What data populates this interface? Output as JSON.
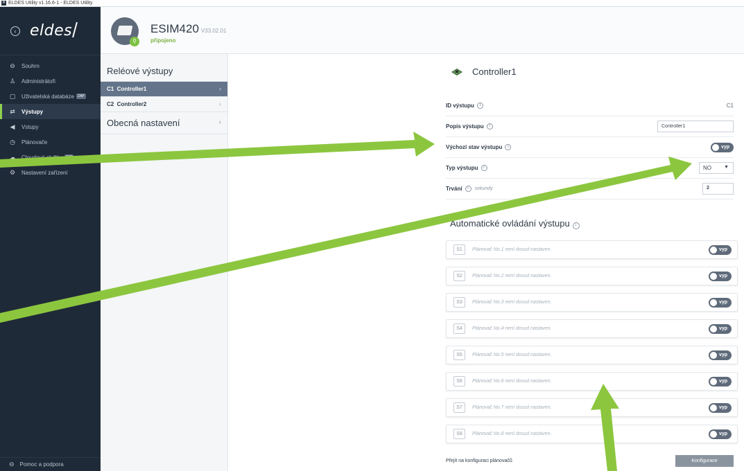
{
  "window": {
    "title": "ELDES Utility v1.16.6-1 - ELDES Utility"
  },
  "brand": {
    "logo": "eldes"
  },
  "sidebar": {
    "items": [
      {
        "label": "Souhrn",
        "icon": "circle-icon",
        "glyph": "⊖",
        "zap": ""
      },
      {
        "label": "Administrátoři",
        "icon": "person-icon",
        "glyph": "♙",
        "zap": ""
      },
      {
        "label": "Uživatelská databáze",
        "icon": "database-icon",
        "glyph": "▢",
        "zap": "ZAP"
      },
      {
        "label": "Výstupy",
        "icon": "outputs-icon",
        "glyph": "⇄",
        "zap": ""
      },
      {
        "label": "Vstupy",
        "icon": "inputs-icon",
        "glyph": "◀",
        "zap": ""
      },
      {
        "label": "Plánovače",
        "icon": "clock-icon",
        "glyph": "◷",
        "zap": ""
      },
      {
        "label": "Cloudové služby",
        "icon": "cloud-icon",
        "glyph": "☁",
        "zap": "ZAP"
      },
      {
        "label": "Nastavení zařízení",
        "icon": "gear-icon",
        "glyph": "⚙",
        "zap": ""
      }
    ],
    "help_label": "Pomoc a podpora"
  },
  "device": {
    "name": "ESIM420",
    "version": "V33.02.01",
    "status": "připojeno"
  },
  "subnav": {
    "title": "Reléové výstupy",
    "items": [
      {
        "label": "C1  Controller1"
      },
      {
        "label": "C2  Controller2"
      }
    ],
    "section": "Obecná nastavení"
  },
  "controller": {
    "title": "Controller1",
    "id_label": "ID výstupu",
    "id_value": "C1",
    "desc_label": "Popis výstupu",
    "desc_value": "Controller1",
    "default_label": "Výchozí stav výstupu",
    "default_state": "vyp",
    "type_label": "Typ výstupu",
    "type_value": "NO",
    "duration_label": "Trvání",
    "duration_units": "sekundy",
    "duration_value": "2"
  },
  "auto": {
    "title": "Automatické ovládání výstupu",
    "schedulers": [
      {
        "id": "S1",
        "text": "Plánovač No.1 není dosud nastaven.",
        "state": "vyp"
      },
      {
        "id": "S2",
        "text": "Plánovač No.2 není dosud nastaven.",
        "state": "vyp"
      },
      {
        "id": "S3",
        "text": "Plánovač No.3 není dosud nastaven.",
        "state": "vyp"
      },
      {
        "id": "S4",
        "text": "Plánovač No.4 není dosud nastaven.",
        "state": "vyp"
      },
      {
        "id": "S5",
        "text": "Plánovač No.5 není dosud nastaven.",
        "state": "vyp"
      },
      {
        "id": "S6",
        "text": "Plánovač No.6 není dosud nastaven.",
        "state": "vyp"
      },
      {
        "id": "S7",
        "text": "Plánovač No.7 není dosud nastaven.",
        "state": "vyp"
      },
      {
        "id": "S8",
        "text": "Plánovač No.8 není dosud nastaven.",
        "state": "vyp"
      }
    ],
    "goto_label": "Přejít na konfiguraci plánovačů",
    "config_button": "Konfigurace"
  },
  "colors": {
    "sidebar": "#1f2a38",
    "accent": "#8fd14f",
    "arrow": "#8cc63f"
  }
}
